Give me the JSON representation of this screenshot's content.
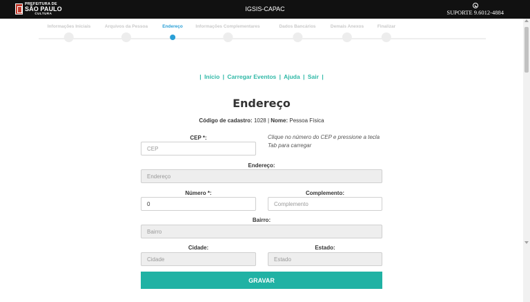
{
  "header": {
    "logo": {
      "line1": "PREFEITURA DE",
      "line2": "SÃO PAULO",
      "line3": "CULTURA"
    },
    "title": "IGSIS-CAPAC",
    "support": "SUPORTE 9.6012-4884",
    "support_icon": "whatsapp-icon"
  },
  "steps": [
    {
      "label": "Informações Iniciais",
      "active": false
    },
    {
      "label": "Arquivos da Pessoa",
      "active": false
    },
    {
      "label": "Endereço",
      "active": true
    },
    {
      "label": "Informações Complementares",
      "active": false
    },
    {
      "label": "Dados Bancários",
      "active": false
    },
    {
      "label": "Demais Anexos",
      "active": false
    },
    {
      "label": "Finalizar",
      "active": false
    }
  ],
  "nav": {
    "inicio": "Início",
    "carregar": "Carregar Eventos",
    "ajuda": "Ajuda",
    "sair": "Sair"
  },
  "page_title": "Endereço",
  "info": {
    "codigo_label": "Código de cadastro:",
    "codigo_value": "1028",
    "nome_label": "Nome:",
    "nome_value": "Pessoa Física"
  },
  "form": {
    "cep": {
      "label": "CEP *:",
      "placeholder": "CEP",
      "value": ""
    },
    "cep_hint": "Clique no número do CEP e pressione a tecla Tab para carregar",
    "endereco": {
      "label": "Endereço:",
      "placeholder": "Endereço"
    },
    "numero": {
      "label": "Número *:",
      "value": "0"
    },
    "complemento": {
      "label": "Complemento:",
      "placeholder": "Complemento"
    },
    "bairro": {
      "label": "Bairro:",
      "placeholder": "Bairro"
    },
    "cidade": {
      "label": "Cidade:",
      "placeholder": "Cidade"
    },
    "estado": {
      "label": "Estado:",
      "placeholder": "Estado"
    },
    "submit_label": "GRAVAR"
  },
  "colors": {
    "accent": "#20b2a4",
    "active_step": "#2a9fd6",
    "topbar": "#111111"
  }
}
